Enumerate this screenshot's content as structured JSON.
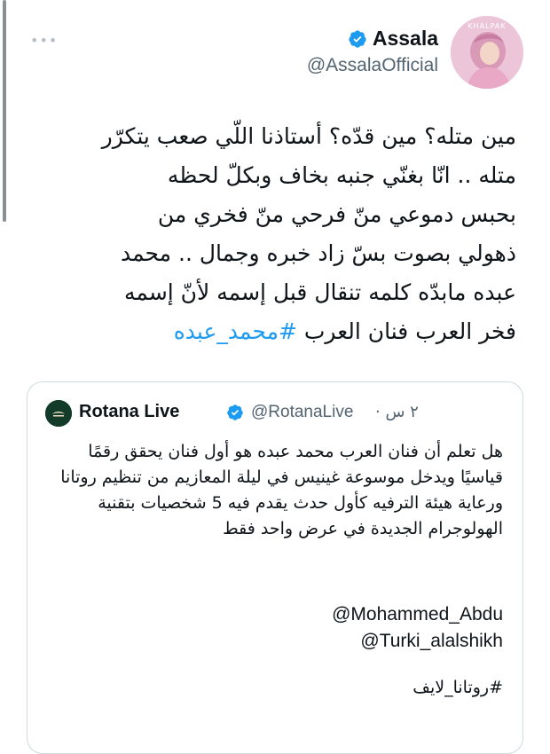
{
  "author": {
    "display_name": "Assala",
    "handle": "@AssalaOfficial",
    "avatar_caption": "KHALPAK"
  },
  "tweet": {
    "lines": [
      "مين متله؟ مين قدّه؟ أستاذنا اللّي صعب يتكرّر",
      "متله .. انّا بغنّي جنبه بخاف وبكلّ لحظه",
      "بحبس دموعي منّ فرحي منّ فخري من",
      "ذهولي بصوت بسّ زاد خبره وجمال .. محمد",
      "عبده مابدّه كلمه تنقال قبل إسمه لأنّ إسمه"
    ],
    "last_line_prefix": "فخر العرب فنان العرب",
    "hashtag": "#محمد_عبده"
  },
  "quote": {
    "display_name": "Rotana Live",
    "handle": "@RotanaLive",
    "time": "٢ س ·",
    "text": "هل تعلم أن فنان العرب محمد عبده هو أول فنان يحقق رقمًا قياسيًا ويدخل موسوعة غينيس في ليلة المعازيم من تنظيم روتانا ورعاية هيئة الترفيه كأول حدث يقدم فيه 5 شخصيات بتقنية الهولوجرام الجديدة في عرض واحد فقط",
    "mentions": [
      "@Mohammed_Abdu",
      "@Turki_alalshikh"
    ],
    "hashtag": "#روتانا_لايف"
  },
  "colors": {
    "verified": "#1d9bf0",
    "hashtag": "#1d9bf0",
    "secondary_text": "#536471",
    "border": "#cfd9de"
  },
  "icons": {
    "more": "more-horizontal-icon",
    "verified": "verified-badge-icon"
  }
}
